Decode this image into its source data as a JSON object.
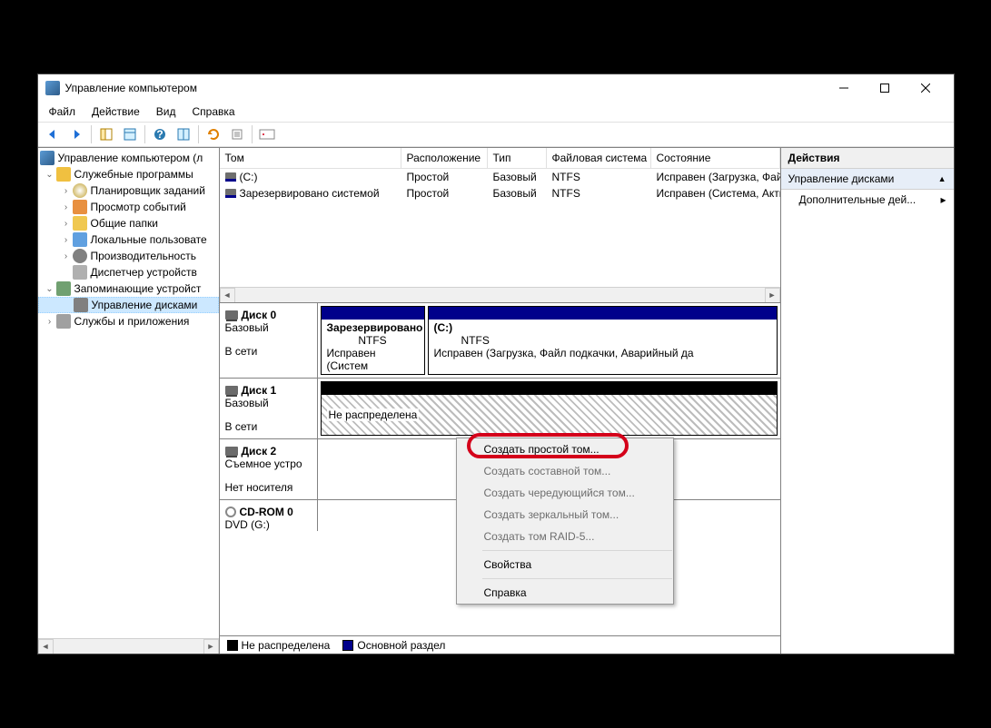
{
  "title": "Управление компьютером",
  "menu": {
    "file": "Файл",
    "action": "Действие",
    "view": "Вид",
    "help": "Справка"
  },
  "tree": {
    "root": "Управление компьютером (л",
    "utilities": "Служебные программы",
    "scheduler": "Планировщик заданий",
    "eventviewer": "Просмотр событий",
    "shared": "Общие папки",
    "localusers": "Локальные пользовате",
    "perf": "Производительность",
    "devmgr": "Диспетчер устройств",
    "storage": "Запоминающие устройст",
    "diskmgmt": "Управление дисками",
    "services": "Службы и приложения"
  },
  "columns": {
    "volume": "Том",
    "layout": "Расположение",
    "type": "Тип",
    "fs": "Файловая система",
    "status": "Состояние"
  },
  "volumes": [
    {
      "name": "(C:)",
      "layout": "Простой",
      "type": "Базовый",
      "fs": "NTFS",
      "status": "Исправен (Загрузка, Файл"
    },
    {
      "name": "Зарезервировано системой",
      "layout": "Простой",
      "type": "Базовый",
      "fs": "NTFS",
      "status": "Исправен (Система, Актив"
    }
  ],
  "disks": {
    "d0": {
      "name": "Диск 0",
      "type": "Базовый",
      "status": "В сети",
      "p1": {
        "name": "Зарезервировано",
        "fs": "NTFS",
        "status": "Исправен (Систем"
      },
      "p2": {
        "name": "(C:)",
        "fs": "NTFS",
        "status": "Исправен (Загрузка, Файл подкачки, Аварийный да"
      }
    },
    "d1": {
      "name": "Диск 1",
      "type": "Базовый",
      "status": "В сети",
      "unalloc": "Не распределена"
    },
    "d2": {
      "name": "Диск 2",
      "type": "Съемное устро",
      "status": "Нет носителя"
    },
    "cd": {
      "name": "CD-ROM 0",
      "type": "DVD (G:)"
    }
  },
  "legend": {
    "unalloc": "Не распределена",
    "primary": "Основной раздел"
  },
  "actions": {
    "title": "Действия",
    "diskmgmt": "Управление дисками",
    "more": "Дополнительные дей..."
  },
  "context": {
    "simple": "Создать простой том...",
    "spanned": "Создать составной том...",
    "striped": "Создать чередующийся том...",
    "mirrored": "Создать зеркальный том...",
    "raid5": "Создать том RAID-5...",
    "props": "Свойства",
    "help": "Справка"
  }
}
